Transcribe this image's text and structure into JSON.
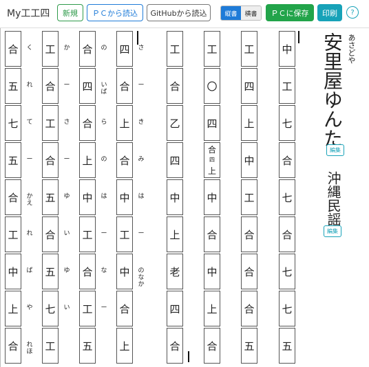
{
  "toolbar": {
    "title": "My工工四",
    "new_label": "新規",
    "load_pc_label": "ＰＣから読込",
    "load_github_label": "GitHubから読込",
    "vertical_label": "縦書",
    "horizontal_label": "横書",
    "save_pc_label": "ＰＣに保存",
    "print_label": "印刷",
    "help_label": "?"
  },
  "song": {
    "title": "安里屋ゆんた",
    "title_ruby": "あさどや",
    "genre": "沖縄民謡",
    "edit_label": "編集"
  },
  "score_columns": [
    {
      "cells": [
        "中",
        "工",
        "七",
        "合",
        "七",
        "合",
        "七",
        "七",
        "五"
      ],
      "lyrics": []
    },
    {
      "cells": [
        "工",
        "四",
        "上",
        "中",
        "工",
        "合",
        "合",
        "合",
        "五"
      ],
      "lyrics": []
    },
    {
      "cells": [
        "工",
        "〇",
        "四",
        "合|四|上",
        "中",
        "合",
        "中",
        "上",
        "合"
      ],
      "lyrics": []
    },
    {
      "cells": [
        "工",
        "合",
        "乙",
        "四",
        "中",
        "上",
        "老",
        "四",
        "合"
      ],
      "lyrics": []
    },
    {
      "cells": [
        "四",
        "合",
        "上",
        "合",
        "中",
        "工",
        "中",
        "合",
        "上"
      ],
      "lyrics": [
        "さ",
        "ー",
        "き",
        "み",
        "は",
        "ー",
        "のなか"
      ]
    },
    {
      "cells": [
        "合",
        "四",
        "合",
        "上",
        "中",
        "工",
        "合",
        "工",
        "五"
      ],
      "lyrics": [
        "の",
        "いば",
        "ら",
        "の",
        "は",
        "ー",
        "な",
        "ー"
      ]
    },
    {
      "cells": [
        "工",
        "合",
        "工",
        "合",
        "五",
        "合",
        "五",
        "七",
        "工"
      ],
      "lyrics": [
        "か",
        "ー",
        "さ",
        "ー",
        "ゆ",
        "い",
        "ゆ",
        "い"
      ]
    },
    {
      "cells": [
        "合",
        "五",
        "七",
        "五",
        "合",
        "工",
        "中",
        "上",
        "合"
      ],
      "lyrics": [
        "く",
        "れ",
        "て",
        "ー",
        "かえ",
        "れ",
        "ば",
        "や",
        "れほ"
      ]
    }
  ]
}
